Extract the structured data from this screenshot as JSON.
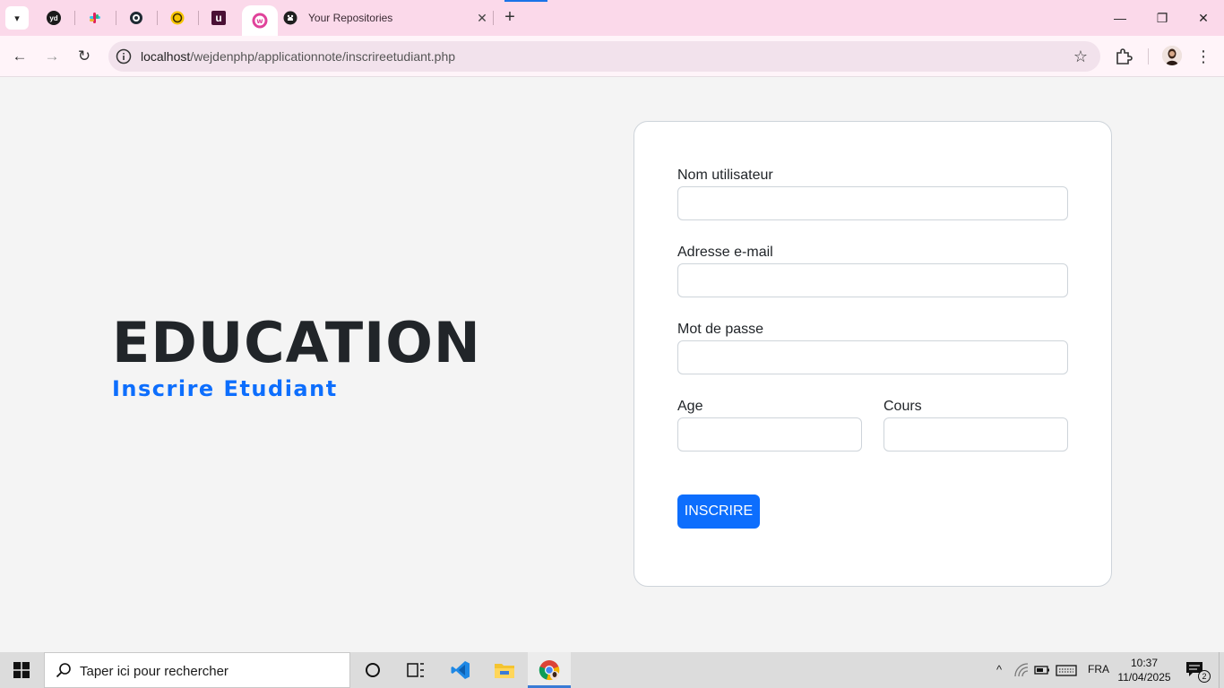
{
  "browser": {
    "tabs": {
      "pinned": [
        {
          "name": "yd",
          "glyph": "yd",
          "color": "#1a1a1a"
        },
        {
          "name": "slack",
          "glyph": "#",
          "color": "#e01e5a"
        },
        {
          "name": "circle-app",
          "glyph": "◎",
          "color": "#1a1a1a"
        },
        {
          "name": "yellow-app",
          "glyph": "☻",
          "color": "#f5c400"
        },
        {
          "name": "udemy",
          "glyph": "u",
          "color": "#5a1a3a"
        },
        {
          "name": "wamp",
          "glyph": "w",
          "color": "#e0429a"
        }
      ],
      "github_tab_title": "Your Repositories",
      "close_glyph": "✕",
      "new_tab_glyph": "+"
    },
    "window": {
      "minimize": "—",
      "restore": "❐",
      "close": "✕"
    },
    "toolbar": {
      "back": "←",
      "forward": "→",
      "reload": "↻",
      "url_host": "localhost",
      "url_path": "/wejdenphp/applicationnote/inscrireetudiant.php",
      "bookmark_star": "☆",
      "menu": "⋮"
    }
  },
  "page": {
    "title": "EDUCATION",
    "subtitle": "Inscrire Etudiant",
    "form": {
      "username_label": "Nom utilisateur",
      "email_label": "Adresse e-mail",
      "password_label": "Mot de passe",
      "age_label": "Age",
      "course_label": "Cours",
      "username_value": "",
      "email_value": "",
      "password_value": "",
      "age_value": "",
      "course_value": "",
      "submit_label": "INSCRIRE"
    },
    "colors": {
      "accent": "#0d6efd",
      "title": "#212529"
    }
  },
  "taskbar": {
    "search_placeholder": "Taper ici pour rechercher",
    "language": "FRA",
    "time": "10:37",
    "date": "11/04/2025",
    "notification_count": "2",
    "tray_chevron": "^"
  }
}
